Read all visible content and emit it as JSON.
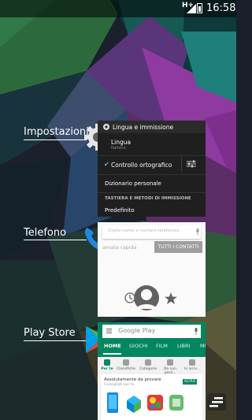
{
  "status_bar": {
    "signal": "H+",
    "time": "16:58"
  },
  "recents": [
    {
      "app": "Impostazioni",
      "icon": "settings-gear-icon"
    },
    {
      "app": "Telefono",
      "icon": "phone-handset-icon"
    },
    {
      "app": "Play Store",
      "icon": "play-store-icon"
    }
  ],
  "settings_card": {
    "title": "Lingua e immissione",
    "language_label": "Lingua",
    "language_value": "Italiano",
    "spell_check": "Controllo ortografico",
    "personal_dictionary": "Dizionario personale",
    "section_header": "TASTIERA E METODI DI IMMISSIONE",
    "default_label": "Predefinito"
  },
  "phone_card": {
    "search_placeholder": "Digita nome o numero telefonico",
    "speed_dial": "amata rapida",
    "all_contacts": "TUTTI I CONTATTI"
  },
  "play_card": {
    "search_placeholder": "Google Play",
    "tabs": [
      "HOME",
      "GIOCHI",
      "FILM",
      "LIBRI",
      "MU"
    ],
    "categories": [
      "Per te",
      "Classifiche",
      "Categorie",
      "Da non perd...",
      "In arriv..."
    ],
    "section_title": "Assolutamente da provare",
    "section_subtitle": "Consigliati per te",
    "more_label": "ALTRO"
  },
  "colors": {
    "play_green": "#01875f",
    "check_blue": "#6ab2e6"
  },
  "fab_icon": "stacked-lines-icon"
}
